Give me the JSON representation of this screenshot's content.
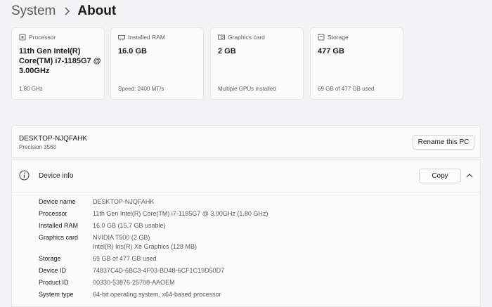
{
  "breadcrumb": {
    "parent": "System",
    "current": "About"
  },
  "cards": [
    {
      "icon": "processor-icon",
      "title": "Processor",
      "value": "11th Gen Intel(R) Core(TM) i7-1185G7 @ 3.00GHz",
      "sub": "1.80 GHz"
    },
    {
      "icon": "ram-icon",
      "title": "Installed RAM",
      "value": "16.0 GB",
      "sub": "Speed: 2400 MT/s"
    },
    {
      "icon": "graphics-card-icon",
      "title": "Graphics card",
      "value": "2 GB",
      "sub": "Multiple GPUs installed"
    },
    {
      "icon": "storage-icon",
      "title": "Storage",
      "value": "477 GB",
      "sub": "69 GB of 477 GB used"
    }
  ],
  "pc": {
    "name": "DESKTOP-NJQFAHK",
    "model": "Precision 3560",
    "rename_label": "Rename this PC"
  },
  "device_info": {
    "title": "Device info",
    "copy_label": "Copy",
    "rows": [
      {
        "label": "Device name",
        "value": "DESKTOP-NJQFAHK"
      },
      {
        "label": "Processor",
        "value": "11th Gen Intel(R) Core(TM) i7-1185G7 @ 3.00GHz (1.80 GHz)"
      },
      {
        "label": "Installed RAM",
        "value": "16.0 GB (15.7 GB usable)"
      },
      {
        "label": "Graphics card",
        "value": "NVIDIA T500 (2 GB)",
        "value2": "Intel(R) Iris(R) Xe Graphics (128 MB)"
      },
      {
        "label": "Storage",
        "value": "69 GB of 477 GB used"
      },
      {
        "label": "Device ID",
        "value": "74837C4D-6BC3-4F03-BD48-6CF1C19D50D7"
      },
      {
        "label": "Product ID",
        "value": "00330-53876-25708-AAOEM"
      },
      {
        "label": "System type",
        "value": "64-bit operating system, x64-based processor"
      }
    ]
  }
}
